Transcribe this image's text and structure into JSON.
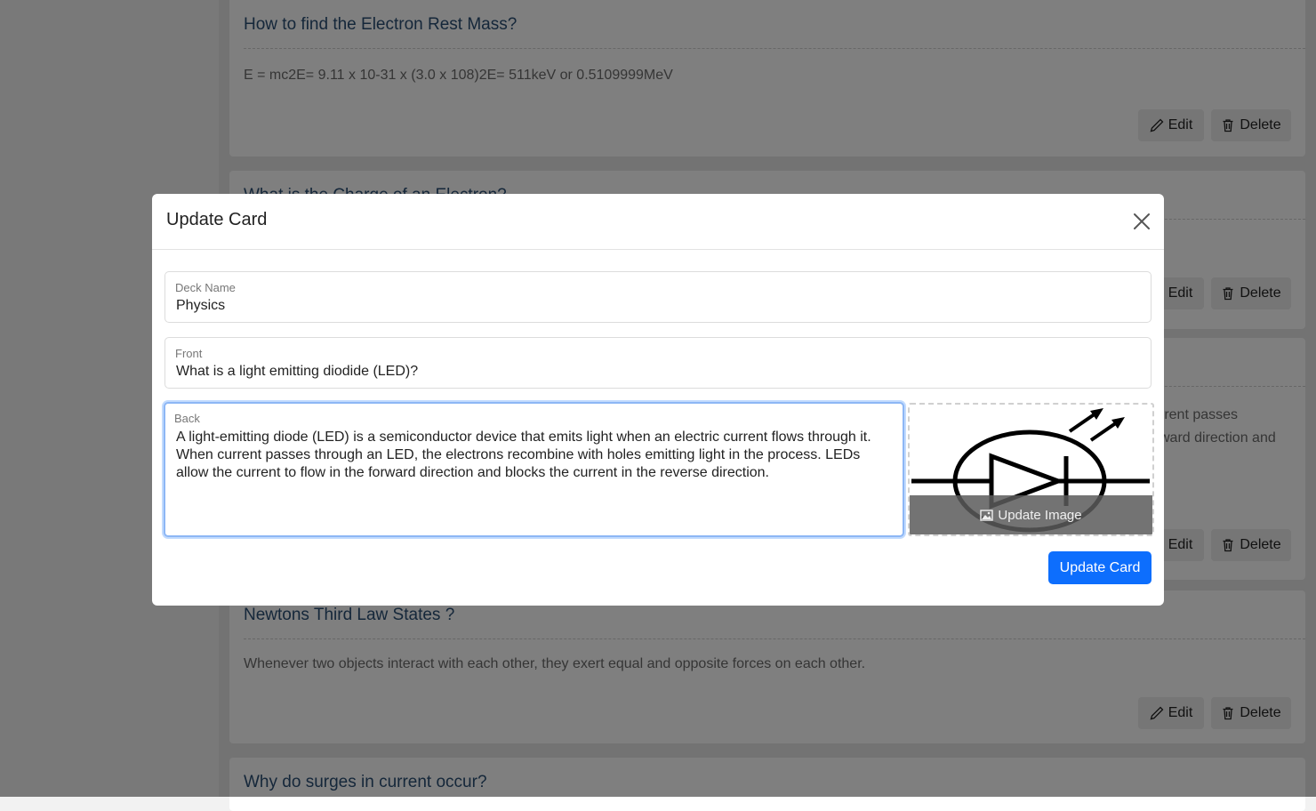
{
  "background": {
    "cards": [
      {
        "question": "How to find the Electron Rest Mass?",
        "answer": "E = mc2E= 9.11 x 10-31 x (3.0 x 108)2E= 511keV or 0.5109999MeV"
      },
      {
        "question": "What is the Charge of an Electron?",
        "answer": ""
      },
      {
        "question": "",
        "answer_line1": "rrent passes",
        "answer_line2": "ward direction and"
      },
      {
        "question": "Newtons Third Law States ?",
        "answer": "Whenever two objects interact with each other, they exert equal and opposite forces on each other."
      },
      {
        "question": "Why do surges in current occur?"
      }
    ],
    "edit_label": "Edit",
    "delete_label": "Delete"
  },
  "modal": {
    "title": "Update Card",
    "deck_name": {
      "label": "Deck Name",
      "value": "Physics"
    },
    "front": {
      "label": "Front",
      "value": "What is a light emitting diodide (LED)?"
    },
    "back": {
      "label": "Back",
      "value": "A light-emitting diode (LED) is a semiconductor device that emits light when an electric current flows through it. When current passes through an LED, the electrons recombine with holes emitting light in the process. LEDs allow the current to flow in the forward direction and blocks the current in the reverse direction."
    },
    "update_image_label": "Update Image",
    "submit_label": "Update Card"
  },
  "colors": {
    "primary": "#0d6efd",
    "question_text": "#2a4f74"
  },
  "icons": [
    "close-icon",
    "pencil-icon",
    "trash-icon",
    "image-icon",
    "led-diode-symbol"
  ]
}
